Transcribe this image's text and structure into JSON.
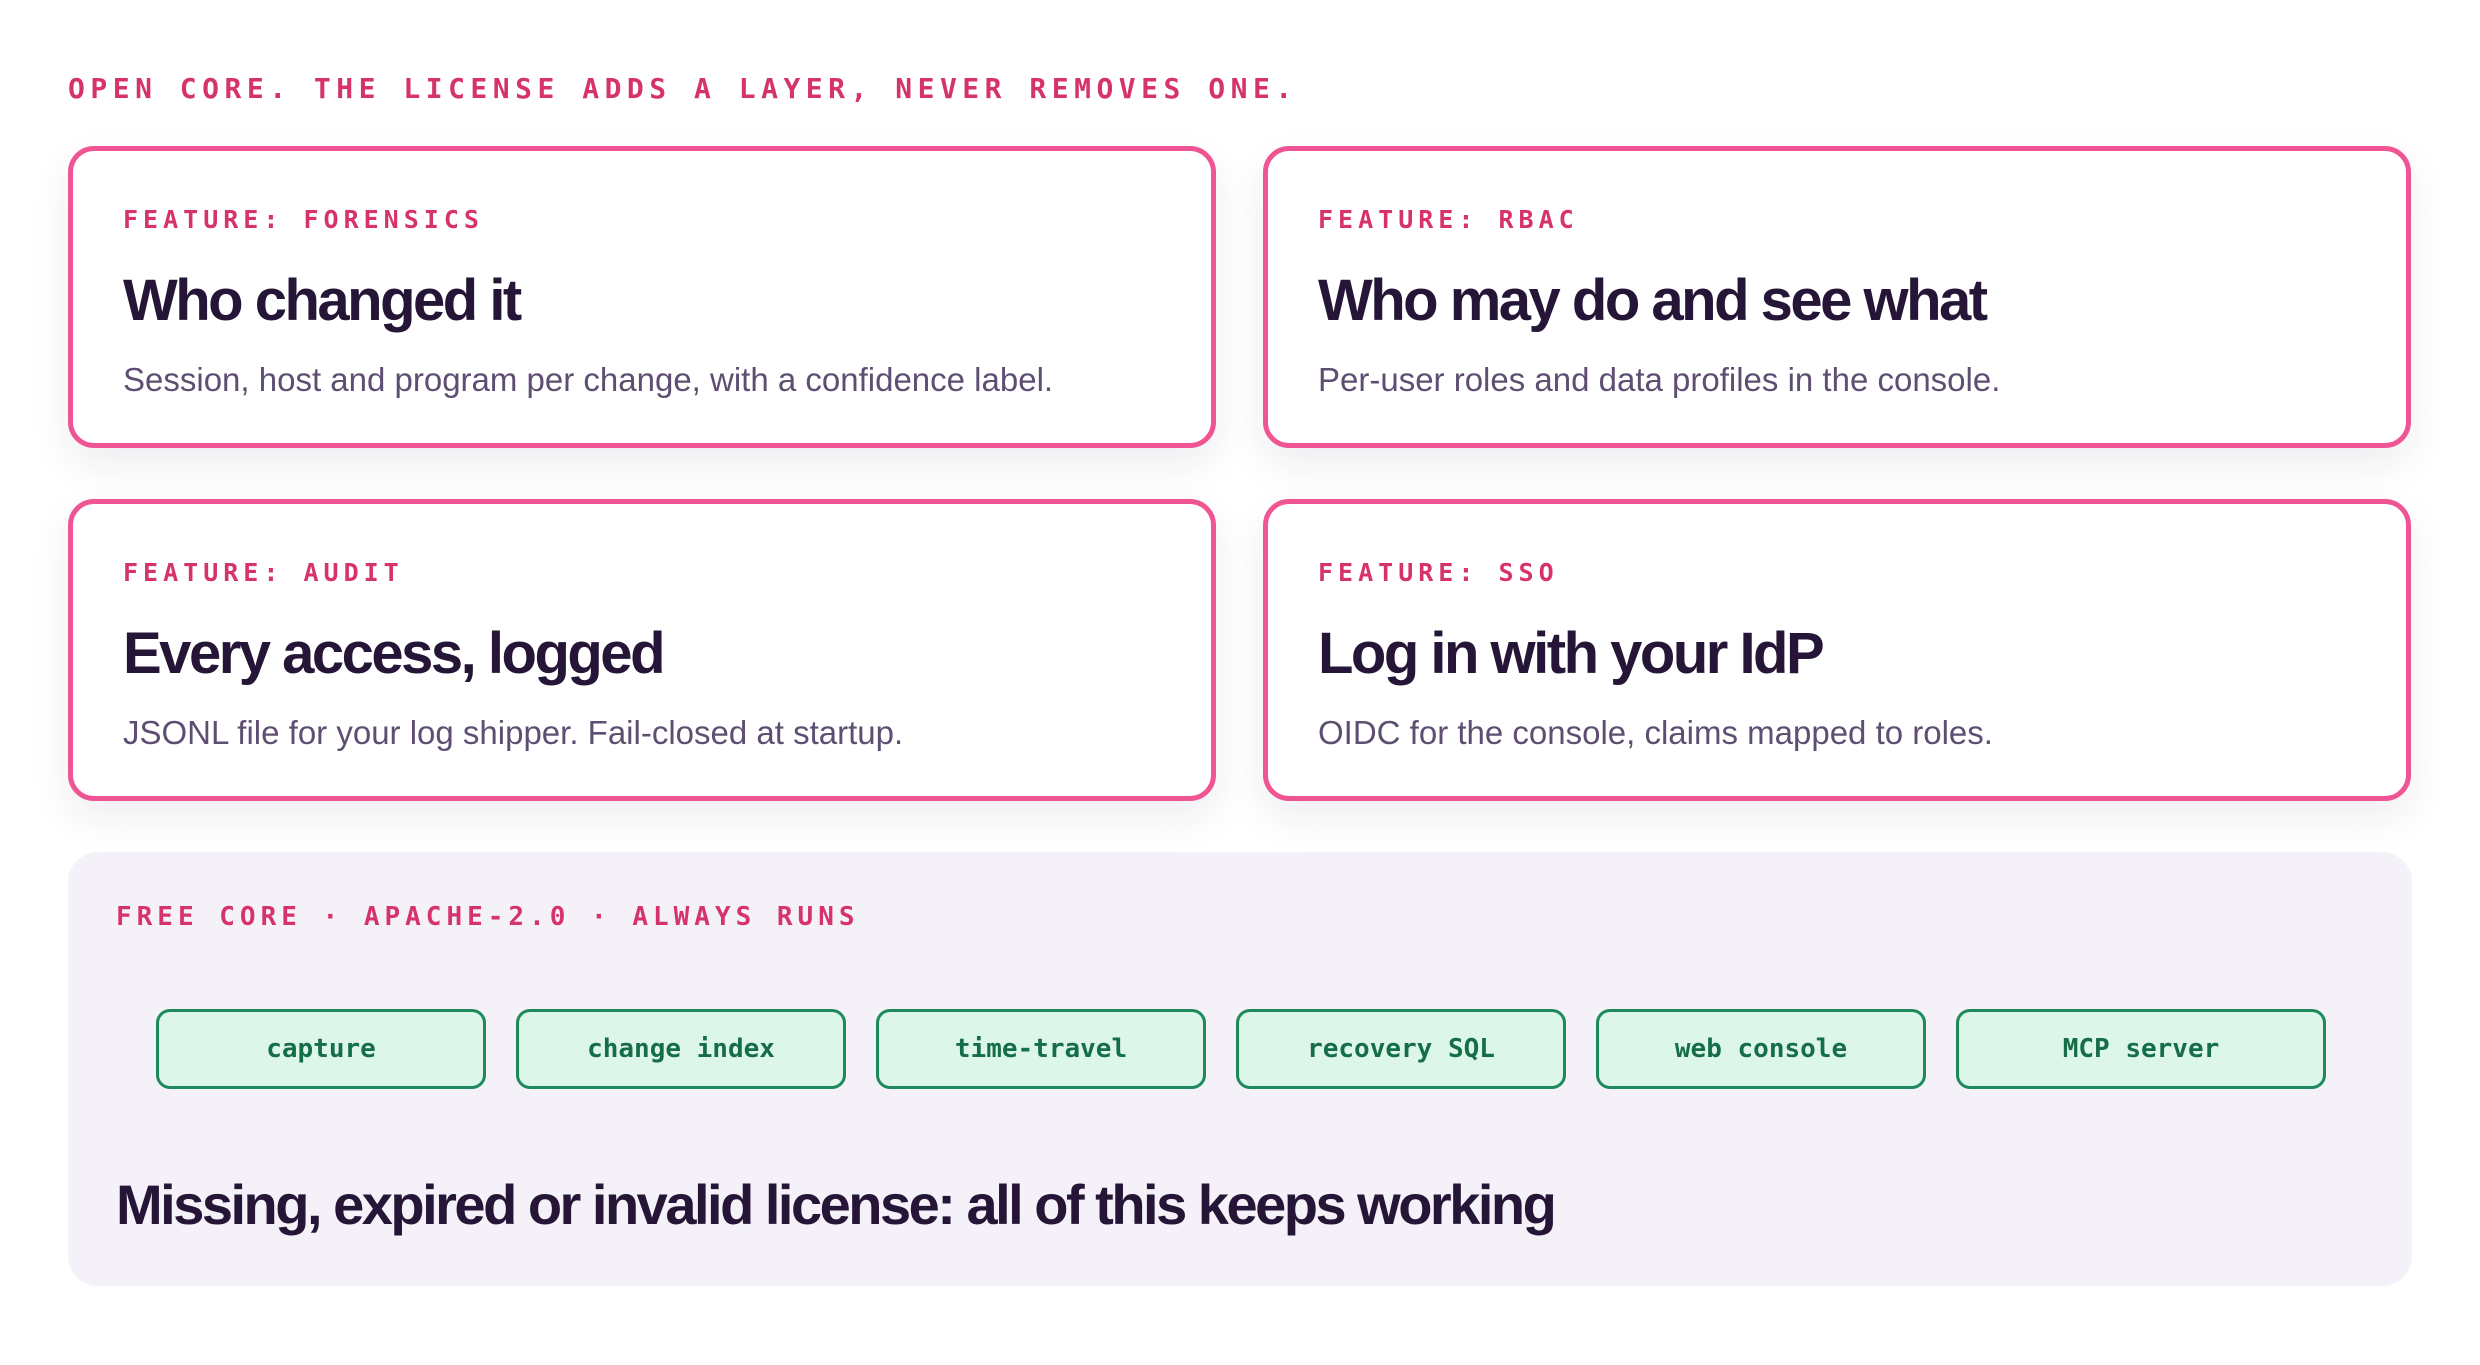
{
  "intro": {
    "tagline": "OPEN CORE. THE LICENSE ADDS A LAYER, NEVER REMOVES ONE."
  },
  "features": [
    {
      "label": "FEATURE: FORENSICS",
      "title": "Who changed it",
      "description": "Session, host and program per change, with a confidence label."
    },
    {
      "label": "FEATURE: RBAC",
      "title": "Who may do and see what",
      "description": "Per-user roles and data profiles in the console."
    },
    {
      "label": "FEATURE: AUDIT",
      "title": "Every access, logged",
      "description": "JSONL file for your log shipper. Fail-closed at startup."
    },
    {
      "label": "FEATURE: SSO",
      "title": "Log in with your IdP",
      "description": "OIDC for the console, claims mapped to roles."
    }
  ],
  "free_core": {
    "label": "FREE CORE · APACHE-2.0 · ALWAYS RUNS",
    "components": [
      "capture",
      "change index",
      "time-travel",
      "recovery SQL",
      "web console",
      "MCP server"
    ],
    "note": "Missing, expired or invalid license: all of this keeps working"
  },
  "colors": {
    "accent_pink": "#d6336c",
    "card_border": "#ee5592",
    "heading": "#251536",
    "body_text": "#5e4f72",
    "chip_border": "#1e8a5c",
    "chip_fill": "#ddf6ea",
    "chip_text": "#166e49",
    "panel_bg": "#f4f2f8"
  }
}
